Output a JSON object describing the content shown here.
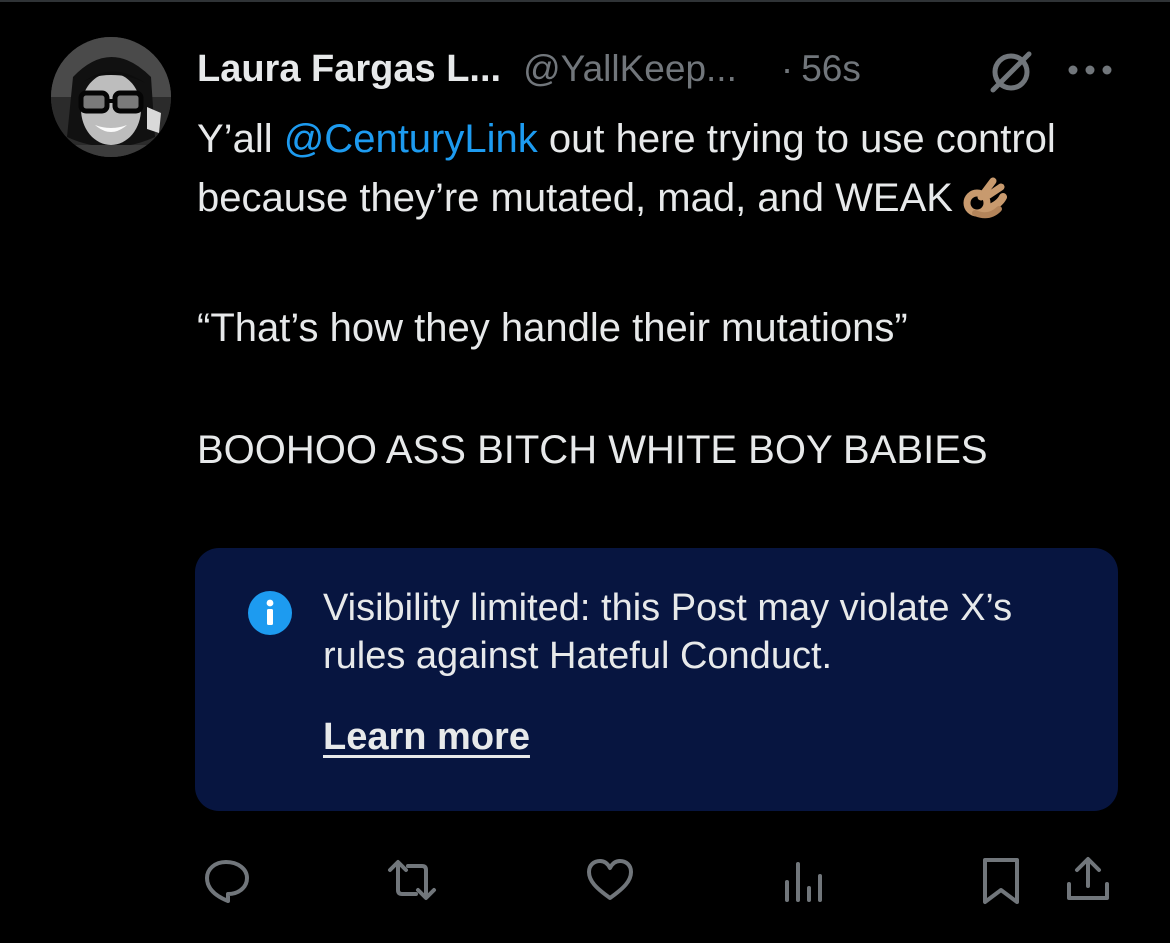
{
  "tweet": {
    "author": {
      "display_name": "Laura Fargas L...",
      "handle": "@YallKeep...",
      "avatar_icon": "profile-photo"
    },
    "separator": "·",
    "timestamp": "56s",
    "header_icons": [
      "no-reply-icon",
      "more-icon"
    ],
    "text": {
      "line1_prefix": "Y’all ",
      "mention": "@CenturyLink",
      "line1_suffix": " out here trying to use control because they’re mutated, mad, and WEAK",
      "emoji": "ok-hand-emoji",
      "quote": "“That’s how they handle their mutations”",
      "shout": "BOOHOO ASS BITCH WHITE BOY BABIES"
    },
    "notice": {
      "text": "Visibility limited: this Post may violate X’s rules against Hateful Conduct.",
      "link_label": "Learn more",
      "background": "#071540",
      "icon_color": "#1d9bf0"
    },
    "actions": [
      "reply-icon",
      "repost-icon",
      "like-icon",
      "views-icon",
      "bookmark-icon",
      "share-icon"
    ]
  },
  "colors": {
    "background": "#000000",
    "text": "#e7e9ea",
    "secondary": "#71767b",
    "accent": "#1d9bf0"
  }
}
